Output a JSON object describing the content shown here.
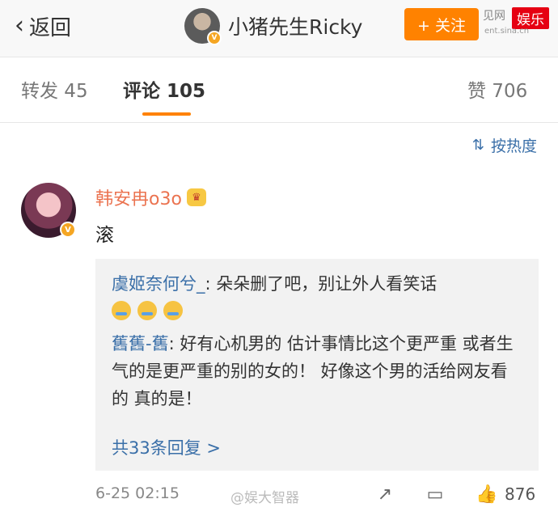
{
  "header": {
    "back_label": "返回",
    "user_name": "小猪先生Ricky",
    "follow_label": "+ 关注",
    "watermark_badge": "娱乐",
    "watermark_pre": "见网",
    "watermark_url": "ent.sina.cn"
  },
  "tabs": {
    "repost": "转发 45",
    "comment": "评论 105",
    "like": "赞 706"
  },
  "sort": {
    "label": "按热度",
    "icon": "sort-icon"
  },
  "comment": {
    "user": "韩安冉o3o",
    "text": "滚",
    "replies": [
      {
        "name": "虞姬奈何兮_",
        "sep": ":",
        "text": " 朵朵删了吧，别让外人看笑话"
      },
      {
        "name": "舊舊-舊",
        "sep": ":",
        "text": " 好有心机男的 估计事情比这个更严重 或者生气的是更严重的别的女的！ 好像这个男的活给网友看的 真的是！"
      }
    ],
    "more_replies": "共33条回复 >",
    "time": "6-25 02:15",
    "likes": "876"
  },
  "source_watermark": "@娱大智器"
}
